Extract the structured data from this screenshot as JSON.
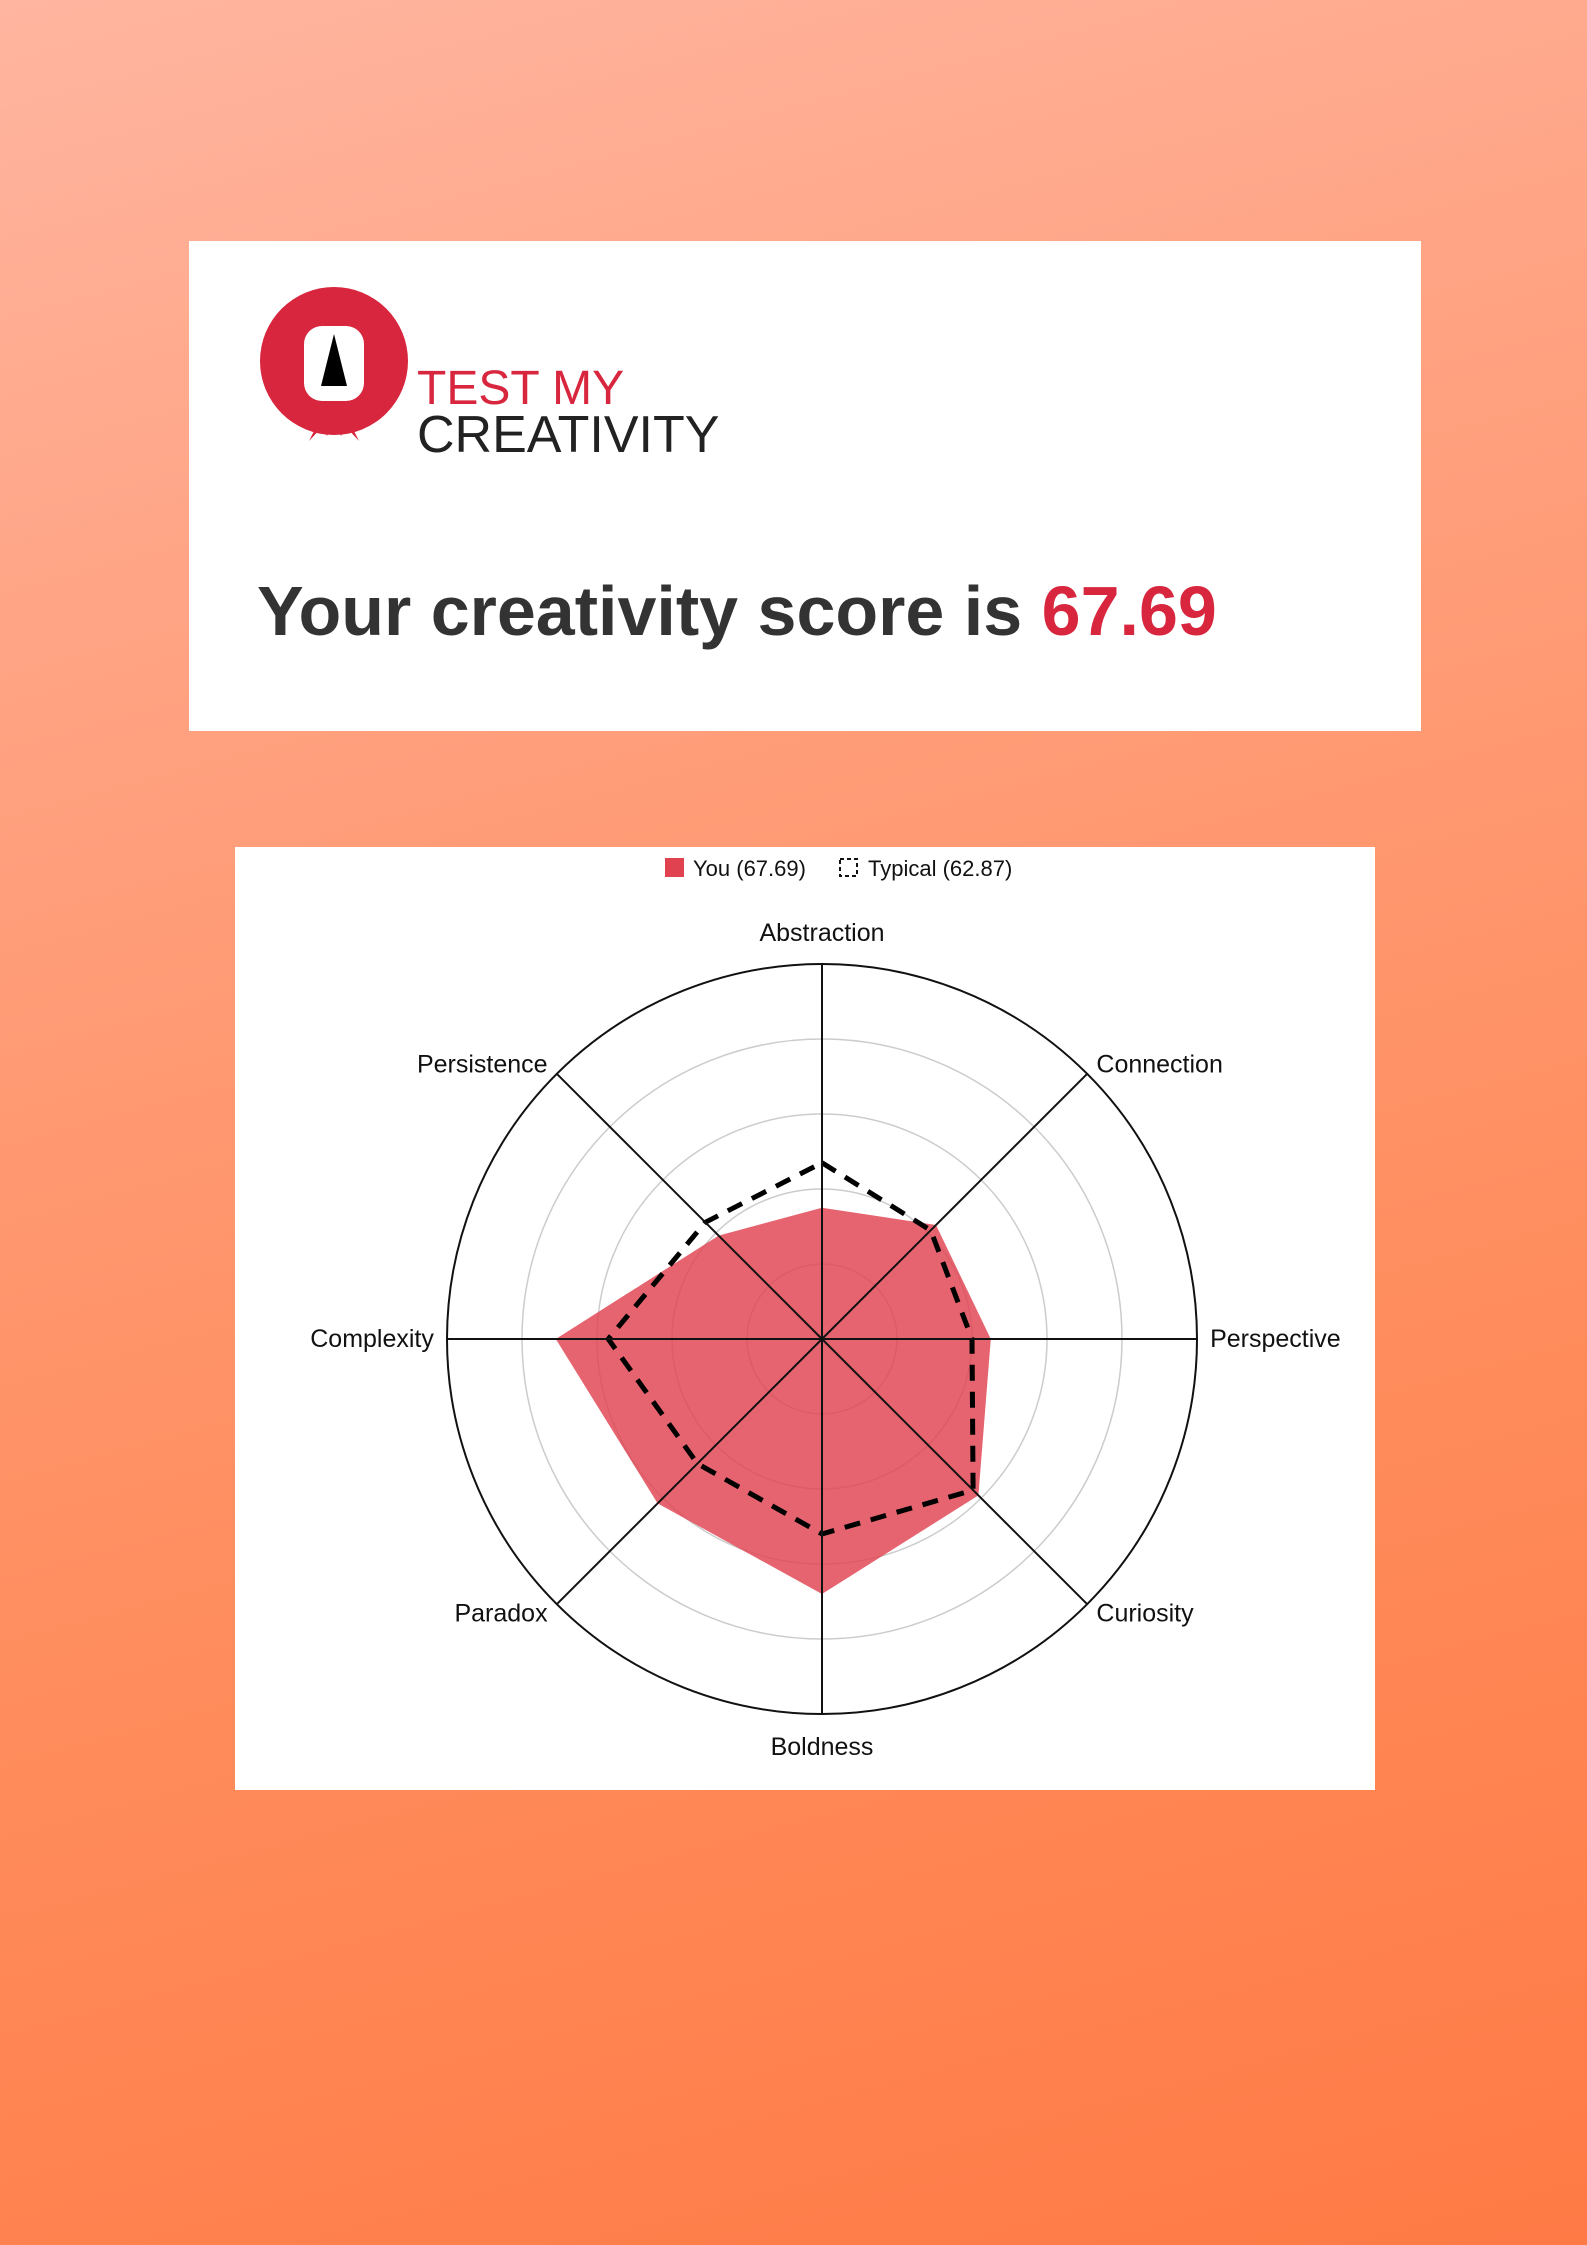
{
  "brand": {
    "line1": "TEST MY",
    "line2": "CREATIVITY",
    "accent_color": "#d7263d"
  },
  "headline": {
    "prefix": "Your creativity score is ",
    "score": "67.69"
  },
  "chart_data": {
    "type": "radar",
    "axes": [
      "Abstraction",
      "Connection",
      "Perspective",
      "Curiosity",
      "Boldness",
      "Paradox",
      "Complexity",
      "Persistence"
    ],
    "rlim": [
      0,
      100
    ],
    "grid": true,
    "legend_position": "top-center",
    "legend": [
      "You (67.69)",
      "Typical (62.87)"
    ],
    "series": [
      {
        "name": "You (67.69)",
        "values": [
          35,
          43,
          45,
          59,
          68,
          62,
          71,
          39
        ],
        "fill_color": "#e0424f",
        "style": "filled"
      },
      {
        "name": "Typical (62.87)",
        "values": [
          47,
          41,
          40,
          57,
          52,
          47,
          57,
          44
        ],
        "line_color": "#000000",
        "style": "dashed"
      }
    ]
  }
}
